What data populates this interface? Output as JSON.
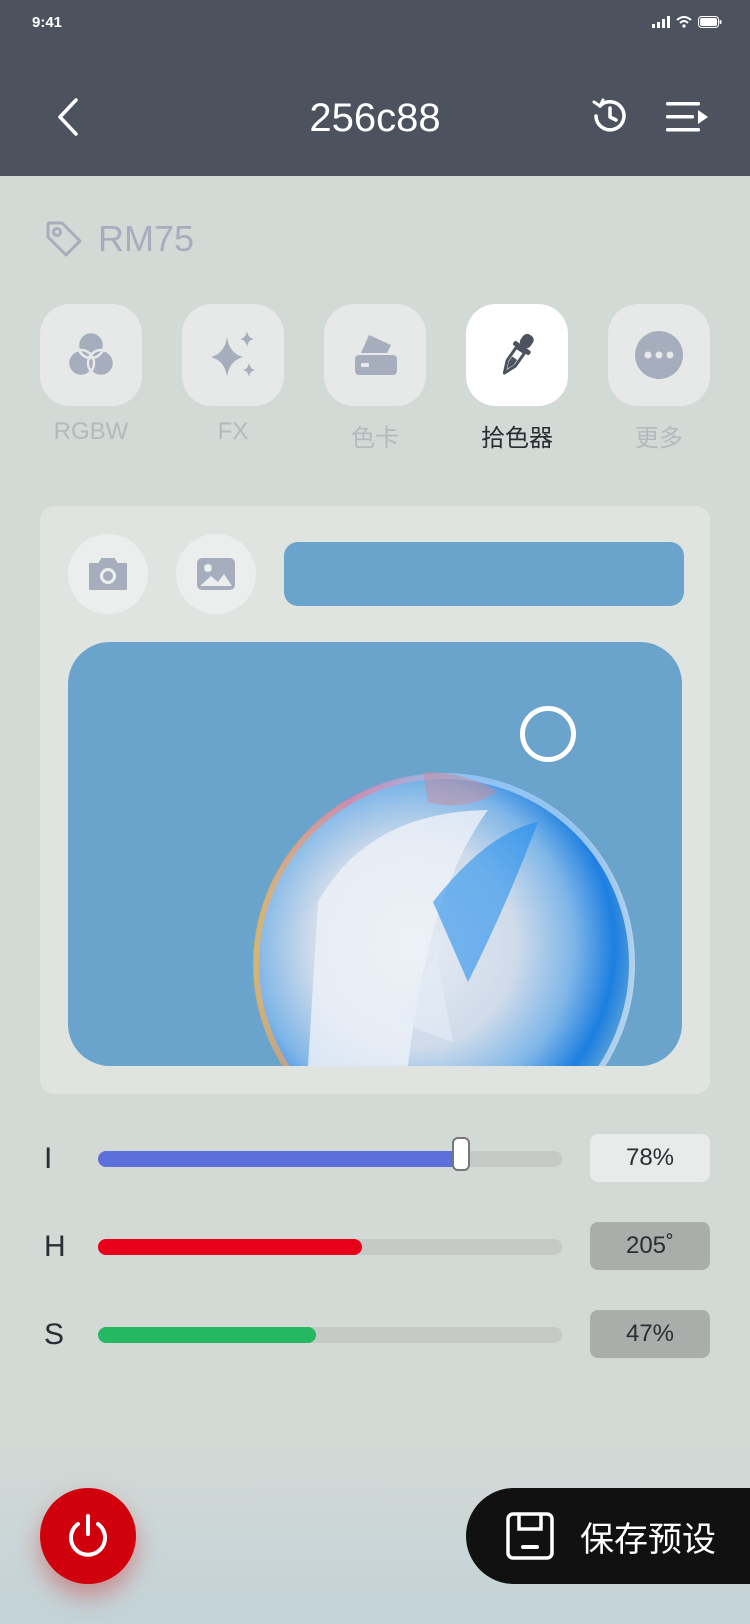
{
  "status_bar": {
    "time": "9:41"
  },
  "header": {
    "title": "256c88"
  },
  "device": {
    "tag": "RM75"
  },
  "tabs": [
    {
      "label": "RGBW",
      "icon": "rgbw-circles-icon",
      "active": false
    },
    {
      "label": "FX",
      "icon": "sparkles-icon",
      "active": false
    },
    {
      "label": "色卡",
      "icon": "color-card-icon",
      "active": false
    },
    {
      "label": "拾色器",
      "icon": "eyedropper-icon",
      "active": true
    },
    {
      "label": "更多",
      "icon": "more-dots-icon",
      "active": false
    }
  ],
  "picker": {
    "selected_color": "#6aa3cb"
  },
  "sliders": [
    {
      "letter": "I",
      "value": "78%",
      "level": 0.78,
      "color": "#5d6fdb",
      "boxed": false
    },
    {
      "letter": "H",
      "value": "205˚",
      "level": 0.57,
      "color": "#e8001b",
      "boxed": true
    },
    {
      "letter": "S",
      "value": "47%",
      "level": 0.47,
      "color": "#23b861",
      "boxed": true
    }
  ],
  "footer": {
    "save_label": "保存预设"
  },
  "colors": {
    "header_bg": "#4d535e",
    "power": "#d0000d",
    "value_box_light": "#e8ebea",
    "value_box_dark": "#a9aeab"
  }
}
